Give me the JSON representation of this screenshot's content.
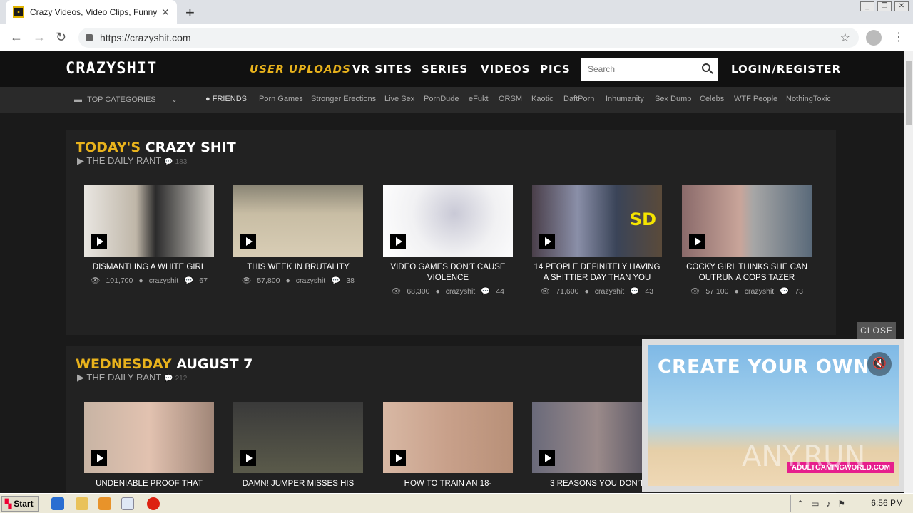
{
  "browser": {
    "tab_title": "Crazy Videos, Video Clips, Funny Vid",
    "url": "https://crazyshit.com"
  },
  "site": {
    "logo": "CRAZYSHIT",
    "nav": [
      "USER UPLOADS",
      "VR SITES",
      "SERIES",
      "VIDEOS",
      "PICS"
    ],
    "search_placeholder": "Search",
    "login": "LOGIN/REGISTER"
  },
  "categories": {
    "top": "TOP CATEGORIES",
    "links": [
      "FRIENDS",
      "Porn Games",
      "Stronger Erections",
      "Live Sex",
      "PornDude",
      "eFukt",
      "ORSM",
      "Kaotic",
      "DaftPorn",
      "Inhumanity",
      "Sex Dump",
      "Celebs",
      "WTF People",
      "NothingToxic"
    ]
  },
  "sections": [
    {
      "title_highlight": "TODAY'S",
      "title_rest": "CRAZY SHIT",
      "rant": "THE DAILY RANT",
      "rant_count": "183",
      "cards": [
        {
          "title": "DISMANTLING A WHITE GIRL",
          "views": "101,700",
          "author": "crazyshit",
          "comments": "67"
        },
        {
          "title": "THIS WEEK IN BRUTALITY",
          "views": "57,800",
          "author": "crazyshit",
          "comments": "38"
        },
        {
          "title": "VIDEO GAMES DON'T CAUSE VIOLENCE",
          "views": "68,300",
          "author": "crazyshit",
          "comments": "44"
        },
        {
          "title": "14 PEOPLE DEFINITELY HAVING A SHITTIER DAY THAN YOU",
          "views": "71,600",
          "author": "crazyshit",
          "comments": "43"
        },
        {
          "title": "COCKY GIRL THINKS SHE CAN OUTRUN A COPS TAZER",
          "views": "57,100",
          "author": "crazyshit",
          "comments": "73"
        }
      ]
    },
    {
      "title_highlight": "WEDNESDAY",
      "title_rest": "AUGUST 7",
      "rant": "THE DAILY RANT",
      "rant_count": "212",
      "cards": [
        {
          "title": "UNDENIABLE PROOF THAT"
        },
        {
          "title": "DAMN! JUMPER MISSES HIS"
        },
        {
          "title": "HOW TO TRAIN AN 18-"
        },
        {
          "title": "3 REASONS YOU DON'T"
        }
      ]
    }
  ],
  "ad": {
    "close": "CLOSE",
    "headline": "CREATE YOUR OWN",
    "brand": "ADULTGAMINGWORLD.COM"
  },
  "taskbar": {
    "start": "Start",
    "clock": "6:56 PM"
  },
  "watermark": "ANY.RUN"
}
